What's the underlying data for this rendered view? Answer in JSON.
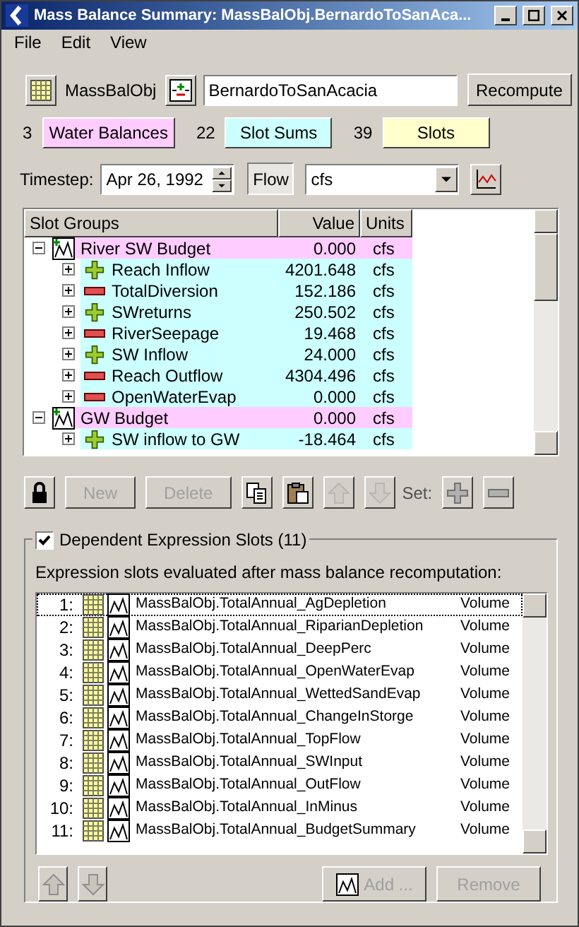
{
  "window": {
    "title": "Mass Balance Summary: MassBalObj.BernardoToSanAca..."
  },
  "menu": [
    "File",
    "Edit",
    "View"
  ],
  "object_row": {
    "label": "MassBalObj",
    "name": "BernardoToSanAcacia",
    "recompute": "Recompute"
  },
  "counts": [
    {
      "count": "3",
      "label": "Water Balances",
      "color": "#ffccff"
    },
    {
      "count": "22",
      "label": "Slot Sums",
      "color": "#ccffff"
    },
    {
      "count": "39",
      "label": "Slots",
      "color": "#ffffcc"
    }
  ],
  "timestep": {
    "label": "Timestep:",
    "date": "Apr 26, 1992",
    "flow": {
      "label": "Flow",
      "selected": true
    },
    "unit": "cfs"
  },
  "tree": {
    "columns": [
      "Slot Groups",
      "Value",
      "Units"
    ],
    "groups": [
      {
        "name": "River SW Budget",
        "value": "0.000",
        "units": "cfs",
        "expanded": true,
        "children": [
          {
            "kind": "plus",
            "name": "Reach Inflow",
            "value": "4201.648",
            "units": "cfs",
            "expanded": false
          },
          {
            "kind": "minus",
            "name": "TotalDiversion",
            "value": "152.186",
            "units": "cfs",
            "expanded": false
          },
          {
            "kind": "plus",
            "name": "SWreturns",
            "value": "250.502",
            "units": "cfs",
            "expanded": false
          },
          {
            "kind": "minus",
            "name": "RiverSeepage",
            "value": "19.468",
            "units": "cfs",
            "expanded": false
          },
          {
            "kind": "plus",
            "name": "SW Inflow",
            "value": "24.000",
            "units": "cfs",
            "expanded": false
          },
          {
            "kind": "minus",
            "name": "Reach Outflow",
            "value": "4304.496",
            "units": "cfs",
            "expanded": false
          },
          {
            "kind": "minus",
            "name": "OpenWaterEvap",
            "value": "0.000",
            "units": "cfs",
            "expanded": false
          }
        ]
      },
      {
        "name": "GW Budget",
        "value": "0.000",
        "units": "cfs",
        "expanded": true,
        "children": [
          {
            "kind": "plus",
            "name": "SW inflow to GW",
            "value": "-18.464",
            "units": "cfs",
            "expanded": false
          }
        ]
      }
    ]
  },
  "actions": [
    {
      "kind": "lock",
      "disabled": false
    },
    {
      "kind": "text",
      "label": "New",
      "disabled": true
    },
    {
      "kind": "text",
      "label": "Delete",
      "disabled": true
    },
    {
      "kind": "copy",
      "disabled": false
    },
    {
      "kind": "paste",
      "disabled": false
    },
    {
      "kind": "up",
      "disabled": true
    },
    {
      "kind": "down",
      "disabled": true
    },
    {
      "kind": "label",
      "label": "Set:"
    },
    {
      "kind": "plus",
      "disabled": false
    },
    {
      "kind": "minus",
      "disabled": false
    }
  ],
  "dependent": {
    "label": "Dependent Expression Slots (11)",
    "checked": true,
    "description": "Expression slots evaluated after mass balance recomputation:",
    "rows": [
      {
        "index": "1:",
        "name": "MassBalObj.TotalAnnual_AgDepletion",
        "units": "Volume",
        "selected": true
      },
      {
        "index": "2:",
        "name": "MassBalObj.TotalAnnual_RiparianDepletion",
        "units": "Volume",
        "selected": false
      },
      {
        "index": "3:",
        "name": "MassBalObj.TotalAnnual_DeepPerc",
        "units": "Volume",
        "selected": false
      },
      {
        "index": "4:",
        "name": "MassBalObj.TotalAnnual_OpenWaterEvap",
        "units": "Volume",
        "selected": false
      },
      {
        "index": "5:",
        "name": "MassBalObj.TotalAnnual_WettedSandEvap",
        "units": "Volume",
        "selected": false
      },
      {
        "index": "6:",
        "name": "MassBalObj.TotalAnnual_ChangeInStorge",
        "units": "Volume",
        "selected": false
      },
      {
        "index": "7:",
        "name": "MassBalObj.TotalAnnual_TopFlow",
        "units": "Volume",
        "selected": false
      },
      {
        "index": "8:",
        "name": "MassBalObj.TotalAnnual_SWInput",
        "units": "Volume",
        "selected": false
      },
      {
        "index": "9:",
        "name": "MassBalObj.TotalAnnual_OutFlow",
        "units": "Volume",
        "selected": false
      },
      {
        "index": "10:",
        "name": "MassBalObj.TotalAnnual_InMinus",
        "units": "Volume",
        "selected": false
      },
      {
        "index": "11:",
        "name": "MassBalObj.TotalAnnual_BudgetSummary",
        "units": "Volume",
        "selected": false
      }
    ],
    "buttons": [
      {
        "kind": "up",
        "disabled": true
      },
      {
        "kind": "down",
        "disabled": true
      },
      {
        "kind": "add",
        "label": "Add ...",
        "disabled": true
      },
      {
        "kind": "text",
        "label": "Remove",
        "disabled": true
      }
    ]
  }
}
